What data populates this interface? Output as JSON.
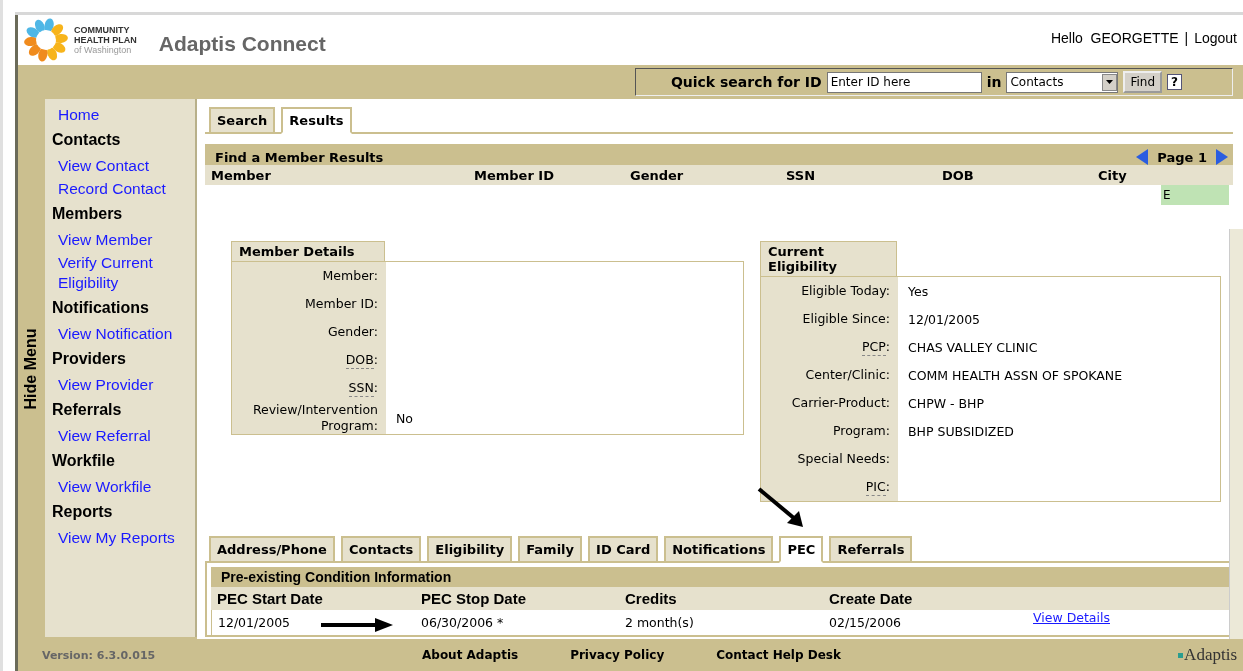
{
  "header": {
    "org_name": [
      "COMMUNITY",
      "HEALTH PLAN"
    ],
    "org_sub": "of Washington",
    "title": "Adaptis Connect",
    "greeting": "Hello  GEORGETTE",
    "separator": "|",
    "logout": "Logout"
  },
  "quick_search": {
    "label": "Quick search for ID",
    "placeholder": "Enter ID here",
    "in_label": "in",
    "scope": "Contacts",
    "find": "Find",
    "help": "?"
  },
  "hide_menu": "Hide Menu",
  "sidebar": [
    {
      "kind": "link",
      "label": "Home"
    },
    {
      "kind": "heading",
      "label": "Contacts"
    },
    {
      "kind": "link",
      "label": "View Contact"
    },
    {
      "kind": "link",
      "label": "Record Contact"
    },
    {
      "kind": "heading",
      "label": "Members"
    },
    {
      "kind": "link",
      "label": "View Member"
    },
    {
      "kind": "link",
      "label": "Verify Current Eligibility"
    },
    {
      "kind": "heading",
      "label": "Notifications"
    },
    {
      "kind": "link",
      "label": "View Notification"
    },
    {
      "kind": "heading",
      "label": "Providers"
    },
    {
      "kind": "link",
      "label": "View Provider"
    },
    {
      "kind": "heading",
      "label": "Referrals"
    },
    {
      "kind": "link",
      "label": "View Referral"
    },
    {
      "kind": "heading",
      "label": "Workfile"
    },
    {
      "kind": "link",
      "label": "View Workfile"
    },
    {
      "kind": "heading",
      "label": "Reports"
    },
    {
      "kind": "link",
      "label": "View My Reports"
    }
  ],
  "version": "Version: 6.3.0.015",
  "tabs": [
    {
      "label": "Search",
      "selected": false
    },
    {
      "label": "Results",
      "selected": true
    }
  ],
  "results": {
    "title": "Find a Member Results",
    "page": "Page 1",
    "columns": [
      "Member",
      "Member ID",
      "Gender",
      "SSN",
      "DOB",
      "City"
    ],
    "partial_cell": "E"
  },
  "member_details": {
    "title": "Member Details",
    "fields": [
      {
        "label": "Member:",
        "abbr": false
      },
      {
        "label": "Member ID:",
        "abbr": false
      },
      {
        "label": "Gender:",
        "abbr": false
      },
      {
        "label": "DOB:",
        "abbr": true
      },
      {
        "label": "SSN:",
        "abbr": true
      },
      {
        "label": "Review/Intervention Program:",
        "value": "No",
        "abbr": false
      }
    ]
  },
  "eligibility": {
    "title": "Current Eligibility",
    "fields": [
      {
        "label": "Eligible Today:",
        "value": "Yes",
        "abbr": false
      },
      {
        "label": "Eligible Since:",
        "value": "12/01/2005",
        "abbr": false
      },
      {
        "label": "PCP:",
        "value": "CHAS VALLEY CLINIC",
        "abbr": true
      },
      {
        "label": "Center/Clinic:",
        "value": "COMM HEALTH ASSN OF SPOKANE",
        "abbr": false
      },
      {
        "label": "Carrier-Product:",
        "value": "CHPW - BHP",
        "abbr": false
      },
      {
        "label": "Program:",
        "value": "BHP SUBSIDIZED",
        "abbr": false
      },
      {
        "label": "Special Needs:",
        "abbr": false
      },
      {
        "label": "PIC:",
        "abbr": true
      }
    ]
  },
  "detail_tabs": [
    {
      "label": "Address/Phone",
      "selected": false
    },
    {
      "label": "Contacts",
      "selected": false
    },
    {
      "label": "Eligibility",
      "selected": false
    },
    {
      "label": "Family",
      "selected": false
    },
    {
      "label": "ID Card",
      "selected": false
    },
    {
      "label": "Notifications",
      "selected": false
    },
    {
      "label": "PEC",
      "selected": true
    },
    {
      "label": "Referrals",
      "selected": false
    }
  ],
  "pec": {
    "title": "Pre-existing Condition Information",
    "columns": [
      "PEC Start Date",
      "PEC Stop Date",
      "Credits",
      "Create Date"
    ],
    "rows": [
      {
        "start": "12/01/2005",
        "stop": "06/30/2006 *",
        "credits": "2 month(s)",
        "created": "02/15/2006",
        "link": "View Details"
      }
    ]
  },
  "footer": {
    "links": [
      "About Adaptis",
      "Privacy Policy",
      "Contact Help Desk"
    ],
    "brand": "Adaptis"
  }
}
